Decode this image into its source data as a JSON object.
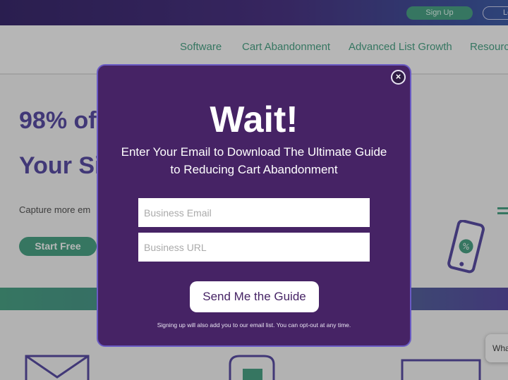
{
  "topbar": {
    "signup_label": "Sign Up",
    "login_label": "Lo"
  },
  "nav": {
    "items": [
      "Software",
      "Cart Abandonment",
      "Advanced List Growth",
      "Resources"
    ]
  },
  "hero": {
    "heading_line1": "98% of",
    "heading_line2": "Your Si",
    "subtext": "Capture more em",
    "cta_label": "Start Free"
  },
  "chat": {
    "label": "Wha"
  },
  "modal": {
    "close_label": "×",
    "title": "Wait!",
    "subtitle_line1": "Enter Your Email to Download The Ultimate Guide",
    "subtitle_line2": "to Reducing Cart Abandonment",
    "email_placeholder": "Business Email",
    "url_placeholder": "Business URL",
    "submit_label": "Send Me the Guide",
    "fine_print": "Signing up will also add you to our email list. You can opt-out at any time."
  },
  "colors": {
    "brand_purple": "#462365",
    "accent_green": "#4ba487",
    "heading_purple": "#5b4ea6"
  }
}
